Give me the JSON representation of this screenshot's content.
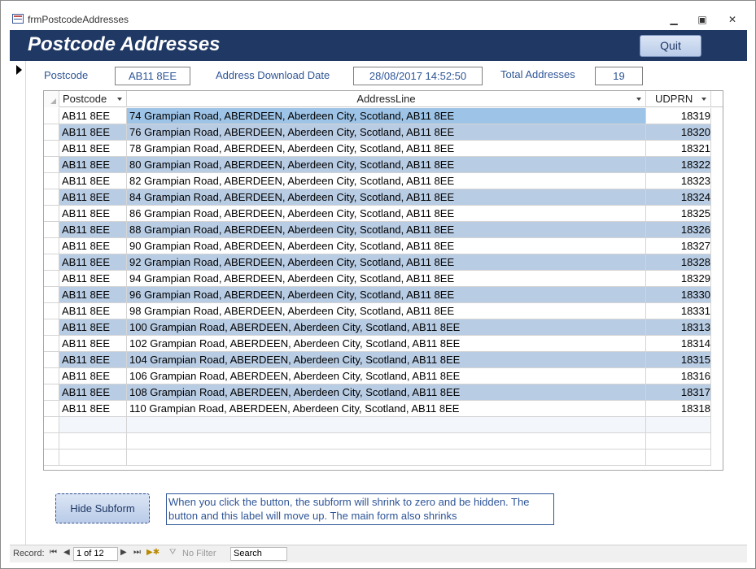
{
  "window": {
    "title": "frmPostcodeAddresses",
    "minimize_glyph": "▁",
    "restore_glyph": "▣",
    "close_glyph": "✕"
  },
  "header": {
    "title": "Postcode Addresses",
    "quit_label": "Quit"
  },
  "fields": {
    "postcode_label": "Postcode",
    "postcode_value": "AB11 8EE",
    "download_label": "Address Download Date",
    "download_value": "28/08/2017 14:52:50",
    "total_label": "Total Addresses",
    "total_value": "19"
  },
  "grid": {
    "columns": [
      "Postcode",
      "AddressLine",
      "UDPRN"
    ],
    "rows": [
      {
        "postcode": "AB11 8EE",
        "address": "74 Grampian Road, ABERDEEN, Aberdeen City, Scotland, AB11 8EE",
        "udprn": "18319"
      },
      {
        "postcode": "AB11 8EE",
        "address": "76 Grampian Road, ABERDEEN, Aberdeen City, Scotland, AB11 8EE",
        "udprn": "18320"
      },
      {
        "postcode": "AB11 8EE",
        "address": "78 Grampian Road, ABERDEEN, Aberdeen City, Scotland, AB11 8EE",
        "udprn": "18321"
      },
      {
        "postcode": "AB11 8EE",
        "address": "80 Grampian Road, ABERDEEN, Aberdeen City, Scotland, AB11 8EE",
        "udprn": "18322"
      },
      {
        "postcode": "AB11 8EE",
        "address": "82 Grampian Road, ABERDEEN, Aberdeen City, Scotland, AB11 8EE",
        "udprn": "18323"
      },
      {
        "postcode": "AB11 8EE",
        "address": "84 Grampian Road, ABERDEEN, Aberdeen City, Scotland, AB11 8EE",
        "udprn": "18324"
      },
      {
        "postcode": "AB11 8EE",
        "address": "86 Grampian Road, ABERDEEN, Aberdeen City, Scotland, AB11 8EE",
        "udprn": "18325"
      },
      {
        "postcode": "AB11 8EE",
        "address": "88 Grampian Road, ABERDEEN, Aberdeen City, Scotland, AB11 8EE",
        "udprn": "18326"
      },
      {
        "postcode": "AB11 8EE",
        "address": "90 Grampian Road, ABERDEEN, Aberdeen City, Scotland, AB11 8EE",
        "udprn": "18327"
      },
      {
        "postcode": "AB11 8EE",
        "address": "92 Grampian Road, ABERDEEN, Aberdeen City, Scotland, AB11 8EE",
        "udprn": "18328"
      },
      {
        "postcode": "AB11 8EE",
        "address": "94 Grampian Road, ABERDEEN, Aberdeen City, Scotland, AB11 8EE",
        "udprn": "18329"
      },
      {
        "postcode": "AB11 8EE",
        "address": "96 Grampian Road, ABERDEEN, Aberdeen City, Scotland, AB11 8EE",
        "udprn": "18330"
      },
      {
        "postcode": "AB11 8EE",
        "address": "98 Grampian Road, ABERDEEN, Aberdeen City, Scotland, AB11 8EE",
        "udprn": "18331"
      },
      {
        "postcode": "AB11 8EE",
        "address": "100 Grampian Road, ABERDEEN, Aberdeen City, Scotland, AB11 8EE",
        "udprn": "18313"
      },
      {
        "postcode": "AB11 8EE",
        "address": "102 Grampian Road, ABERDEEN, Aberdeen City, Scotland, AB11 8EE",
        "udprn": "18314"
      },
      {
        "postcode": "AB11 8EE",
        "address": "104 Grampian Road, ABERDEEN, Aberdeen City, Scotland, AB11 8EE",
        "udprn": "18315"
      },
      {
        "postcode": "AB11 8EE",
        "address": "106 Grampian Road, ABERDEEN, Aberdeen City, Scotland, AB11 8EE",
        "udprn": "18316"
      },
      {
        "postcode": "AB11 8EE",
        "address": "108 Grampian Road, ABERDEEN, Aberdeen City, Scotland, AB11 8EE",
        "udprn": "18317"
      },
      {
        "postcode": "AB11 8EE",
        "address": "110 Grampian Road, ABERDEEN, Aberdeen City, Scotland, AB11 8EE",
        "udprn": "18318"
      }
    ]
  },
  "footer": {
    "hide_button_label": "Hide Subform",
    "info_text": "When you click the button, the subform will shrink to zero and be hidden. The button and this label will move up. The main form also shrinks"
  },
  "navbar": {
    "record_label": "Record:",
    "record_value": "1 of 12",
    "filter_label": "No Filter",
    "search_label": "Search"
  },
  "colors": {
    "header_bg": "#1f3864",
    "label_text": "#2e5597",
    "alt_row": "#b8cce4",
    "current_cell": "#9dc3e6"
  }
}
